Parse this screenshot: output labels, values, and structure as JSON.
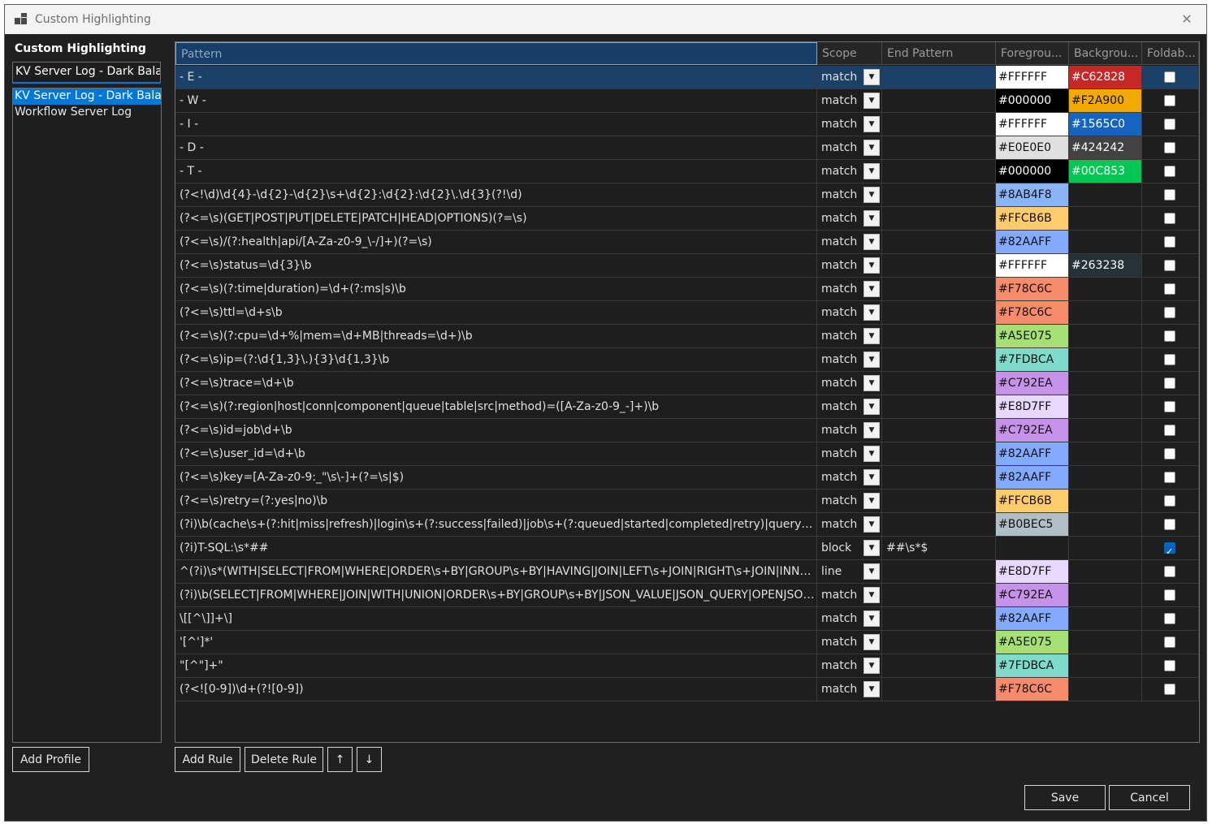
{
  "window": {
    "title": "Custom Highlighting"
  },
  "profiles": {
    "header": "Custom Highlighting",
    "name_value": "KV Server Log - Dark Balanced",
    "items": [
      {
        "label": "KV Server Log - Dark Balanced",
        "selected": true
      },
      {
        "label": "Workflow Server Log",
        "selected": false
      }
    ],
    "add_label": "Add Profile"
  },
  "grid": {
    "columns": [
      "Pattern",
      "Scope",
      "End Pattern",
      "Foregrou...",
      "Backgrou...",
      "Foldab..."
    ],
    "rows": [
      {
        "pattern": "- E -",
        "scope": "match",
        "end": "",
        "fg": "#FFFFFF",
        "bg": "#C62828",
        "fold": false
      },
      {
        "pattern": "- W -",
        "scope": "match",
        "end": "",
        "fg": "#000000",
        "bg": "#F2A900",
        "fold": false
      },
      {
        "pattern": "- I -",
        "scope": "match",
        "end": "",
        "fg": "#FFFFFF",
        "bg": "#1565C0",
        "fold": false
      },
      {
        "pattern": "- D -",
        "scope": "match",
        "end": "",
        "fg": "#E0E0E0",
        "bg": "#424242",
        "fold": false
      },
      {
        "pattern": "- T -",
        "scope": "match",
        "end": "",
        "fg": "#000000",
        "bg": "#00C853",
        "fold": false
      },
      {
        "pattern": "(?<!\\d)\\d{4}-\\d{2}-\\d{2}\\s+\\d{2}:\\d{2}:\\d{2}\\.\\d{3}(?!\\d)",
        "scope": "match",
        "end": "",
        "fg": "#8AB4F8",
        "bg": "",
        "fold": false
      },
      {
        "pattern": "(?<=\\s)(GET|POST|PUT|DELETE|PATCH|HEAD|OPTIONS)(?=\\s)",
        "scope": "match",
        "end": "",
        "fg": "#FFCB6B",
        "bg": "",
        "fold": false
      },
      {
        "pattern": "(?<=\\s)/(?:health|api/[A-Za-z0-9_\\-/]+)(?=\\s)",
        "scope": "match",
        "end": "",
        "fg": "#82AAFF",
        "bg": "",
        "fold": false
      },
      {
        "pattern": "(?<=\\s)status=\\d{3}\\b",
        "scope": "match",
        "end": "",
        "fg": "#FFFFFF",
        "bg": "#263238",
        "fold": false
      },
      {
        "pattern": "(?<=\\s)(?:time|duration)=\\d+(?:ms|s)\\b",
        "scope": "match",
        "end": "",
        "fg": "#F78C6C",
        "bg": "",
        "fold": false
      },
      {
        "pattern": "(?<=\\s)ttl=\\d+s\\b",
        "scope": "match",
        "end": "",
        "fg": "#F78C6C",
        "bg": "",
        "fold": false
      },
      {
        "pattern": "(?<=\\s)(?:cpu=\\d+%|mem=\\d+MB|threads=\\d+)\\b",
        "scope": "match",
        "end": "",
        "fg": "#A5E075",
        "bg": "",
        "fold": false
      },
      {
        "pattern": "(?<=\\s)ip=(?:\\d{1,3}\\.){3}\\d{1,3}\\b",
        "scope": "match",
        "end": "",
        "fg": "#7FDBCA",
        "bg": "",
        "fold": false
      },
      {
        "pattern": "(?<=\\s)trace=\\d+\\b",
        "scope": "match",
        "end": "",
        "fg": "#C792EA",
        "bg": "",
        "fold": false
      },
      {
        "pattern": "(?<=\\s)(?:region|host|conn|component|queue|table|src|method)=([A-Za-z0-9_-]+)\\b",
        "scope": "match",
        "end": "",
        "fg": "#E8D7FF",
        "bg": "",
        "fold": false
      },
      {
        "pattern": "(?<=\\s)id=job\\d+\\b",
        "scope": "match",
        "end": "",
        "fg": "#C792EA",
        "bg": "",
        "fold": false
      },
      {
        "pattern": "(?<=\\s)user_id=\\d+\\b",
        "scope": "match",
        "end": "",
        "fg": "#82AAFF",
        "bg": "",
        "fold": false
      },
      {
        "pattern": "(?<=\\s)key=[A-Za-z0-9:_\"\\s\\-]+(?=\\s|$)",
        "scope": "match",
        "end": "",
        "fg": "#82AAFF",
        "bg": "",
        "fold": false
      },
      {
        "pattern": "(?<=\\s)retry=(?:yes|no)\\b",
        "scope": "match",
        "end": "",
        "fg": "#FFCB6B",
        "bg": "",
        "fold": false
      },
      {
        "pattern": "(?i)\\b(cache\\s+(?:hit|miss|refresh)|login\\s+(?:success|failed)|job\\s+(?:queued|started|completed|retry)|query\\s+execu...",
        "scope": "match",
        "end": "",
        "fg": "#B0BEC5",
        "bg": "",
        "fold": false
      },
      {
        "pattern": "(?i)T-SQL:\\s*##",
        "scope": "block",
        "end": "##\\s*$",
        "fg": "",
        "bg": "",
        "fold": true
      },
      {
        "pattern": "^(?i)\\s*(WITH|SELECT|FROM|WHERE|ORDER\\s+BY|GROUP\\s+BY|HAVING|JOIN|LEFT\\s+JOIN|RIGHT\\s+JOIN|INNER\\s+...",
        "scope": "line",
        "end": "",
        "fg": "#E8D7FF",
        "bg": "",
        "fold": false
      },
      {
        "pattern": "(?i)\\b(SELECT|FROM|WHERE|JOIN|WITH|UNION|ORDER\\s+BY|GROUP\\s+BY|JSON_VALUE|JSON_QUERY|OPENJSON|S...",
        "scope": "match",
        "end": "",
        "fg": "#C792EA",
        "bg": "",
        "fold": false
      },
      {
        "pattern": "\\[[^\\]]+\\]",
        "scope": "match",
        "end": "",
        "fg": "#82AAFF",
        "bg": "",
        "fold": false
      },
      {
        "pattern": "'[^']*'",
        "scope": "match",
        "end": "",
        "fg": "#A5E075",
        "bg": "",
        "fold": false
      },
      {
        "pattern": "\"[^\"]+\"",
        "scope": "match",
        "end": "",
        "fg": "#7FDBCA",
        "bg": "",
        "fold": false
      },
      {
        "pattern": "(?<![0-9])\\d+(?![0-9])",
        "scope": "match",
        "end": "",
        "fg": "#F78C6C",
        "bg": "",
        "fold": false
      }
    ]
  },
  "actions": {
    "add_rule": "Add Rule",
    "delete_rule": "Delete Rule",
    "move_up": "↑",
    "move_down": "↓",
    "save": "Save",
    "cancel": "Cancel"
  },
  "colors": {
    "accent": "#0078D7",
    "selected_row": "#1C4169",
    "window_bg": "#202020"
  }
}
